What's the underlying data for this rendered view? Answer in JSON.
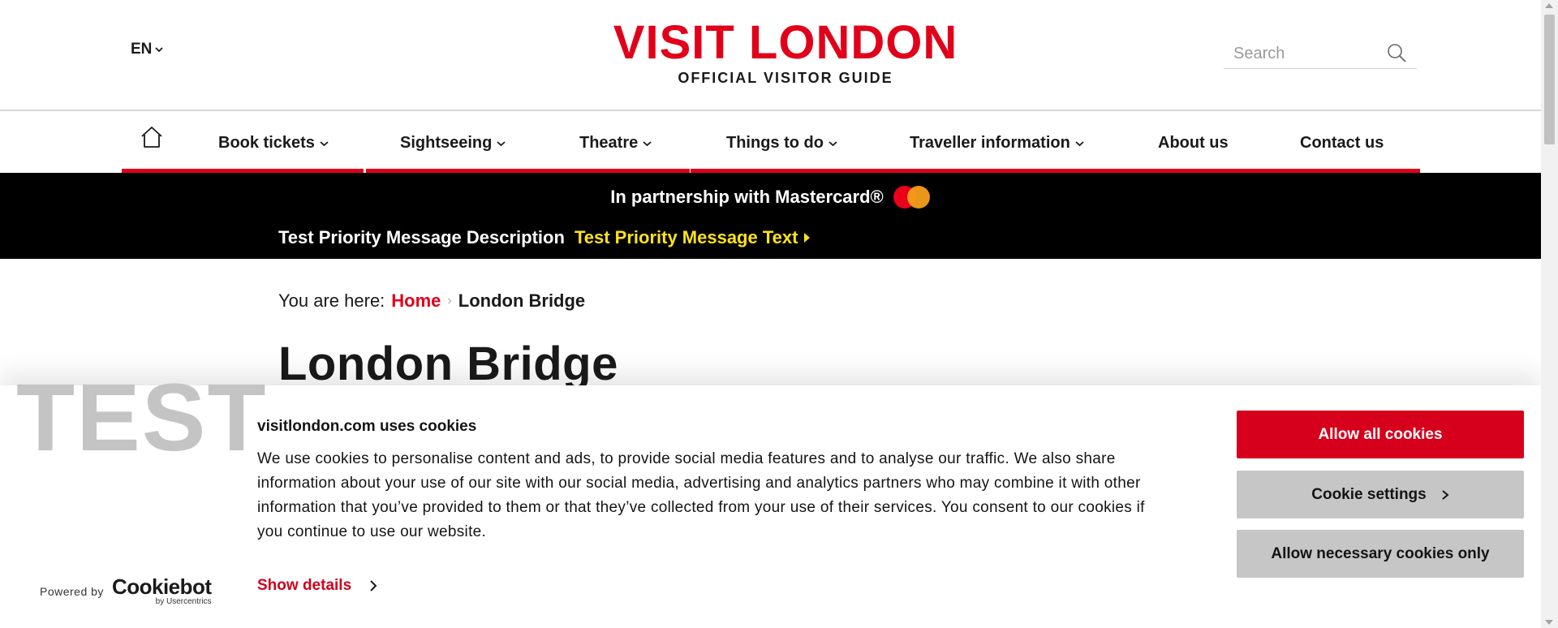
{
  "header": {
    "language": "EN",
    "logo_title": "VISIT LONDON",
    "logo_subtitle": "OFFICIAL VISITOR GUIDE",
    "search_placeholder": "Search"
  },
  "nav": {
    "items": [
      {
        "label": "Book tickets",
        "has_dropdown": true
      },
      {
        "label": "Sightseeing",
        "has_dropdown": true
      },
      {
        "label": "Theatre",
        "has_dropdown": true
      },
      {
        "label": "Things to do",
        "has_dropdown": true
      },
      {
        "label": "Traveller information",
        "has_dropdown": true
      },
      {
        "label": "About us",
        "has_dropdown": false
      },
      {
        "label": "Contact us",
        "has_dropdown": false
      }
    ]
  },
  "promo": {
    "partnership": "In partnership with Mastercard®",
    "priority_description": "Test Priority Message Description",
    "priority_link": "Test Priority Message Text"
  },
  "breadcrumb": {
    "prefix": "You are here:",
    "home": "Home",
    "current": "London Bridge"
  },
  "page": {
    "title": "London Bridge"
  },
  "cookie": {
    "watermark": "TEST",
    "title": "visitlondon.com uses cookies",
    "body": "We use cookies to personalise content and ads, to provide social media features and to analyse our traffic. We also share information about your use of our site with our social media, advertising and analytics partners who may combine it with other information that you’ve provided to them or that they’ve collected from your use of their services. You consent to our cookies if you continue to use our website.",
    "show_details": "Show details",
    "allow_all": "Allow all cookies",
    "settings": "Cookie settings",
    "necessary_only": "Allow necessary cookies only",
    "powered_by": "Powered by",
    "brand": "Cookiebot",
    "brand_sub": "by Usercentrics"
  },
  "colors": {
    "brand_red": "#e1001a",
    "promo_bg": "#000000",
    "priority_link": "#ffe21a",
    "button_gray": "#c6c6c6"
  },
  "icons": {
    "home": "home-icon",
    "search": "search-icon",
    "chevron": "chevron-down-icon",
    "arrow": "arrow-right-icon"
  }
}
